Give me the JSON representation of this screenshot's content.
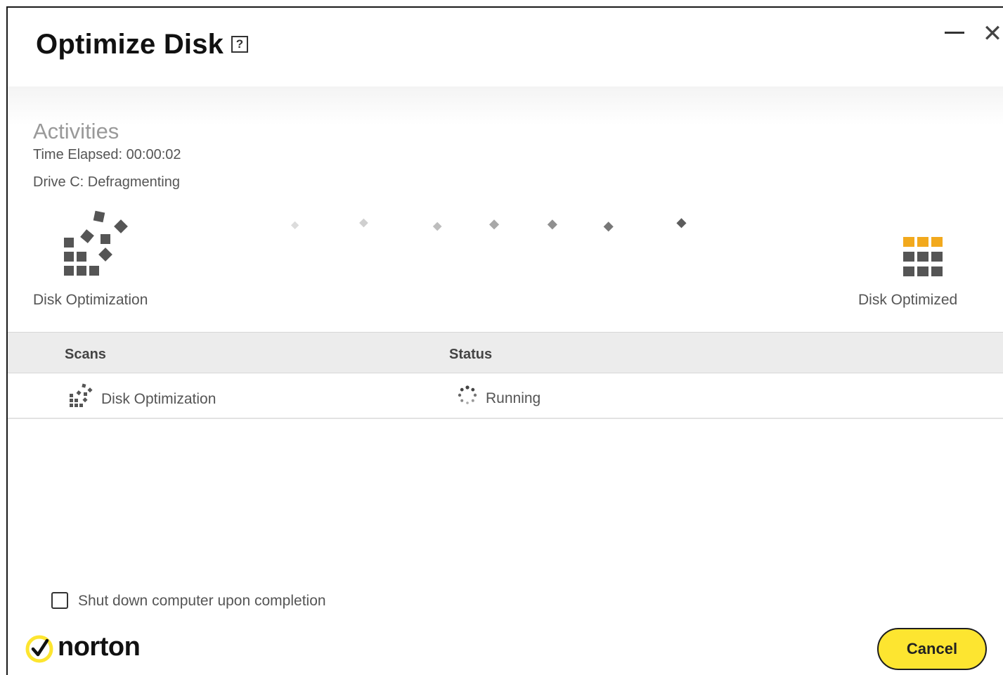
{
  "window": {
    "title": "Optimize Disk",
    "help_label": "?",
    "close_label": "✕"
  },
  "activities": {
    "heading": "Activities",
    "time_elapsed": "Time Elapsed: 00:00:02",
    "drive_status": "Drive C: Defragmenting"
  },
  "progress": {
    "start_label": "Disk Optimization",
    "end_label": "Disk Optimized"
  },
  "table": {
    "columns": [
      "Scans",
      "Status"
    ],
    "rows": [
      {
        "scan": "Disk Optimization",
        "status": "Running",
        "scan_icon": "disk-optimization-icon",
        "status_icon": "spinner-icon"
      }
    ]
  },
  "footer": {
    "shutdown_label": "Shut down computer upon completion",
    "shutdown_checked": false,
    "brand": "norton",
    "cancel_label": "Cancel"
  },
  "colors": {
    "accent_yellow": "#fde530",
    "optimized_orange": "#f2a91d",
    "block_gray": "#555555"
  }
}
